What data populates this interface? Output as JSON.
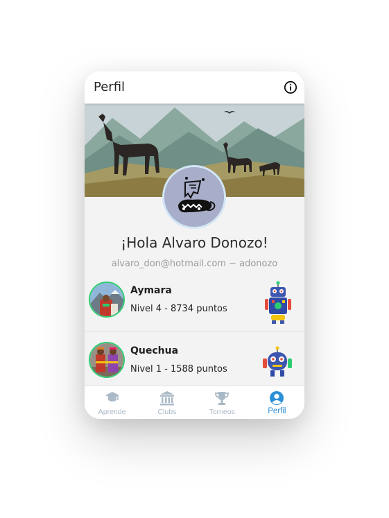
{
  "header": {
    "title": "Perfil",
    "info_icon": "info-circle-icon"
  },
  "profile": {
    "greeting": "¡Hola Alvaro Donozo!",
    "email_line": "alvaro_don@hotmail.com ~ adonozo",
    "avatar_icon": "monster-avatar-icon"
  },
  "languages": [
    {
      "name": "Aymara",
      "level": "Nivel 4 - 8734 puntos",
      "robot_icon": "tall-robot-icon"
    },
    {
      "name": "Quechua",
      "level": "Nivel 1 - 1588 puntos",
      "robot_icon": "small-robot-icon"
    }
  ],
  "tabs": [
    {
      "label": "Aprende",
      "icon": "graduation-cap-icon",
      "active": false
    },
    {
      "label": "Clubs",
      "icon": "building-columns-icon",
      "active": false
    },
    {
      "label": "Torneos",
      "icon": "trophy-icon",
      "active": false
    },
    {
      "label": "Perfil",
      "icon": "user-circle-icon",
      "active": true
    }
  ],
  "colors": {
    "accent": "#2d8fd5",
    "inactive_tab": "#aab9c6",
    "level_ring": "#2ecc71",
    "avatar_bg": "#a8aec9"
  }
}
